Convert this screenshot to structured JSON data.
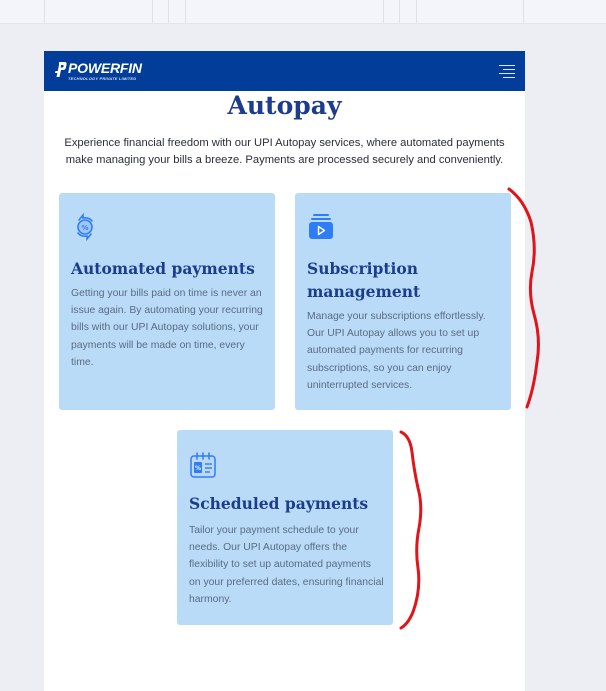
{
  "header": {
    "brand_name": "POWERFIN",
    "brand_tagline": "TECHNOLOGY PRIVATE LIMITED"
  },
  "page": {
    "title": "Autopay",
    "intro": "Experience financial freedom with our UPI Autopay services, where automated payments make managing your bills a breeze. Payments are processed securely and conveniently."
  },
  "cards": [
    {
      "icon": "currency-exchange-icon",
      "title": "Automated payments",
      "text": "Getting your bills paid on time is never an issue again. By automating your recurring bills with our UPI Autopay solutions, your payments will be made on time, every time."
    },
    {
      "icon": "subscription-play-icon",
      "title": "Subscription management",
      "text": "Manage your subscriptions effortlessly. Our UPI Autopay allows you to set up automated payments for recurring subscriptions, so you can enjoy uninterrupted services."
    },
    {
      "icon": "calendar-schedule-icon",
      "title": "Scheduled payments",
      "text": "Tailor your payment schedule to your needs. Our UPI Autopay offers the flexibility to set up automated payments on your preferred dates, ensuring financial harmony."
    }
  ],
  "colors": {
    "nav_bg": "#033d9a",
    "card_bg": "#b9dbf8",
    "heading": "#1c3d8c",
    "icon_blue": "#2f7df6",
    "annotation_red": "#e0141a"
  }
}
